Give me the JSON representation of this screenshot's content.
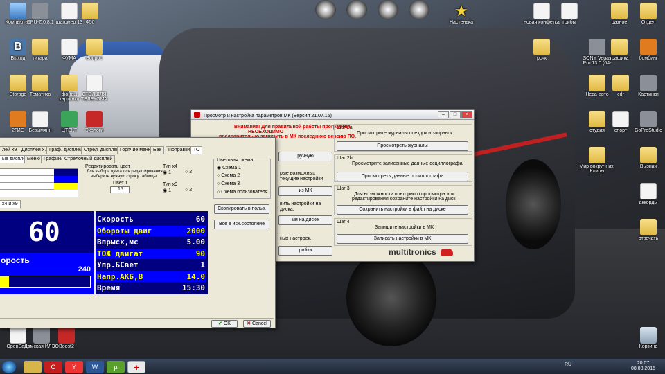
{
  "desktop": {
    "icons_left": [
      {
        "label": "Компьютер",
        "kind": "pc"
      },
      {
        "label": "GPU-Z.0.8.1",
        "kind": "gray"
      },
      {
        "label": "шагомер 13",
        "kind": "doc"
      },
      {
        "label": "Ф50",
        "kind": "folder"
      },
      {
        "label": "Выход",
        "kind": "vk"
      },
      {
        "label": "гитара",
        "kind": "folder"
      },
      {
        "label": "ФУМА",
        "kind": "doc"
      },
      {
        "label": "Вопрос",
        "kind": "folder"
      },
      {
        "label": "Storage",
        "kind": "folder"
      },
      {
        "label": "Тематика",
        "kind": "folder"
      },
      {
        "label": "фонды картинки",
        "kind": "folder"
      },
      {
        "label": "СТОЛ ДЛЯ ТЕЛЕКОМА",
        "kind": "doc"
      },
      {
        "label": "2ГИС",
        "kind": "orange"
      },
      {
        "label": "Безымянн",
        "kind": "doc"
      },
      {
        "label": "ЦТЕКТ",
        "kind": "green"
      },
      {
        "label": "Экологи",
        "kind": "red"
      },
      {
        "label": "OpenSans",
        "kind": "doc"
      },
      {
        "label": "Дамская ИЛЭО",
        "kind": "gray"
      },
      {
        "label": "Boost2",
        "kind": "red"
      }
    ],
    "icons_right": [
      {
        "label": "Настенька",
        "kind": "star"
      },
      {
        "label": "новая конфетка",
        "kind": "doc"
      },
      {
        "label": "грибы",
        "kind": "doc"
      },
      {
        "label": "разное",
        "kind": "folder"
      },
      {
        "label": "Отдел",
        "kind": "folder"
      },
      {
        "label": "рсчк",
        "kind": "folder"
      },
      {
        "label": "SONY Vegas Pro 13.0 (64-",
        "kind": "gray"
      },
      {
        "label": "графика",
        "kind": "folder"
      },
      {
        "label": "бомбинг",
        "kind": "orange"
      },
      {
        "label": "Нева-авто",
        "kind": "folder"
      },
      {
        "label": "cdr",
        "kind": "folder"
      },
      {
        "label": "Картинки",
        "kind": "gray"
      },
      {
        "label": "студия",
        "kind": "folder"
      },
      {
        "label": "спорт",
        "kind": "doc"
      },
      {
        "label": "GoProStudio",
        "kind": "gray"
      },
      {
        "label": "Мир вокруг них. Клипы",
        "kind": "folder"
      },
      {
        "label": "Вызнач",
        "kind": "folder"
      },
      {
        "label": "аккорды",
        "kind": "doc"
      },
      {
        "label": "отвечать",
        "kind": "folder"
      },
      {
        "label": "Корзина",
        "kind": "trash"
      }
    ]
  },
  "taskbar": {
    "language": "RU",
    "time": "20:07",
    "date": "08.08.2015",
    "apps": [
      "explorer",
      "opera",
      "yandex",
      "word",
      "utorrent",
      "multitronics"
    ]
  },
  "main_window": {
    "title": "Просмотр и настройка параметров МК (Версия 21.07.15)",
    "warning_line1": "Внимание! Для правильной работы программы",
    "warning_line2": "НЕОБХОДИМО",
    "warning_line3": "предварительно загрузить в МК последнюю версию ПО.",
    "left_btn_top": "ручную",
    "left_text_2a": "рые возможных",
    "left_text_2b": "текущие настройки",
    "left_btn_mk": "из МК",
    "left_text_3a": "вить настройки на",
    "left_text_3b": "диска.",
    "left_btn_disk": "ии на диске",
    "left_text_4": "ных настроек.",
    "left_btn_bottom": "ройки",
    "step_2a": {
      "title": "Шаг 2a",
      "desc": "Просмотрите журналы поездок и заправок.",
      "button": "Просмотреть журналы"
    },
    "step_2b": {
      "title": "Шаг 2b",
      "desc": "Просмотрите записанные данные осциллографа",
      "button": "Просмотреть данные осциллографа"
    },
    "step_3": {
      "title": "Шаг 3",
      "desc1": "Для возможности повторного просмотра или",
      "desc2": "редактирования сохраните настройки на диск.",
      "button": "Сохранить настройки в файл на диске"
    },
    "step_4": {
      "title": "Шаг 4",
      "desc": "Запишите настройки в МК",
      "button": "Записать настройки в МК"
    },
    "brand": "multitronics"
  },
  "settings_window": {
    "tabs_row1": [
      "лей x9",
      "Дисплеи x7",
      "Граф. дисплеи",
      "Стрел. дисплеи",
      "Горячие меню",
      "Бак",
      "Поправки",
      "ТО"
    ],
    "tabs_row2": [
      "ые дисплеи",
      "Меню",
      "Графики",
      "Стрелочный дисплей"
    ],
    "edit_color_title": "Редактировать цвет",
    "edit_color_hint1": "Для выбора цвета для редактирования",
    "edit_color_hint2": "выберите нужную строку таблицы",
    "color1_label": "Цвет 1",
    "color1_value": "15",
    "type_x4": {
      "title": "Тип x4",
      "opt1": "1",
      "opt2": "2",
      "selected": "1"
    },
    "type_x9": {
      "title": "Тип x9",
      "opt1": "1",
      "opt2": "2",
      "selected": "1"
    },
    "color_scheme": {
      "title": "Цветовая схема",
      "options": [
        "Схема 1",
        "Схема 2",
        "Схема 3",
        "Схема пользователя"
      ],
      "selected": "Схема 1"
    },
    "btn_copy": "Скопировать в польз.",
    "btn_all": "Все в исх.состояние",
    "subtab": "x4 и x9",
    "big_value": "60",
    "left_label": "орость",
    "left_value": "240",
    "bar_percent": 10,
    "lcd_rows": [
      {
        "label": "Скорость",
        "value": "60",
        "style": "dark"
      },
      {
        "label": "Обороты двиг",
        "value": "2000",
        "style": "yel"
      },
      {
        "label": "Впрыск,мс",
        "value": "5.00",
        "style": "dark"
      },
      {
        "label": "ТОЖ двигат",
        "value": "90",
        "style": "yel"
      },
      {
        "label": "Упр.БСвет",
        "value": "1",
        "style": "dark"
      },
      {
        "label": "Напр.АКБ,В",
        "value": "14.0",
        "style": "yel"
      },
      {
        "label": "Время",
        "value": "15:30",
        "style": "dark"
      }
    ],
    "ok": "OK",
    "cancel": "Cancel"
  }
}
